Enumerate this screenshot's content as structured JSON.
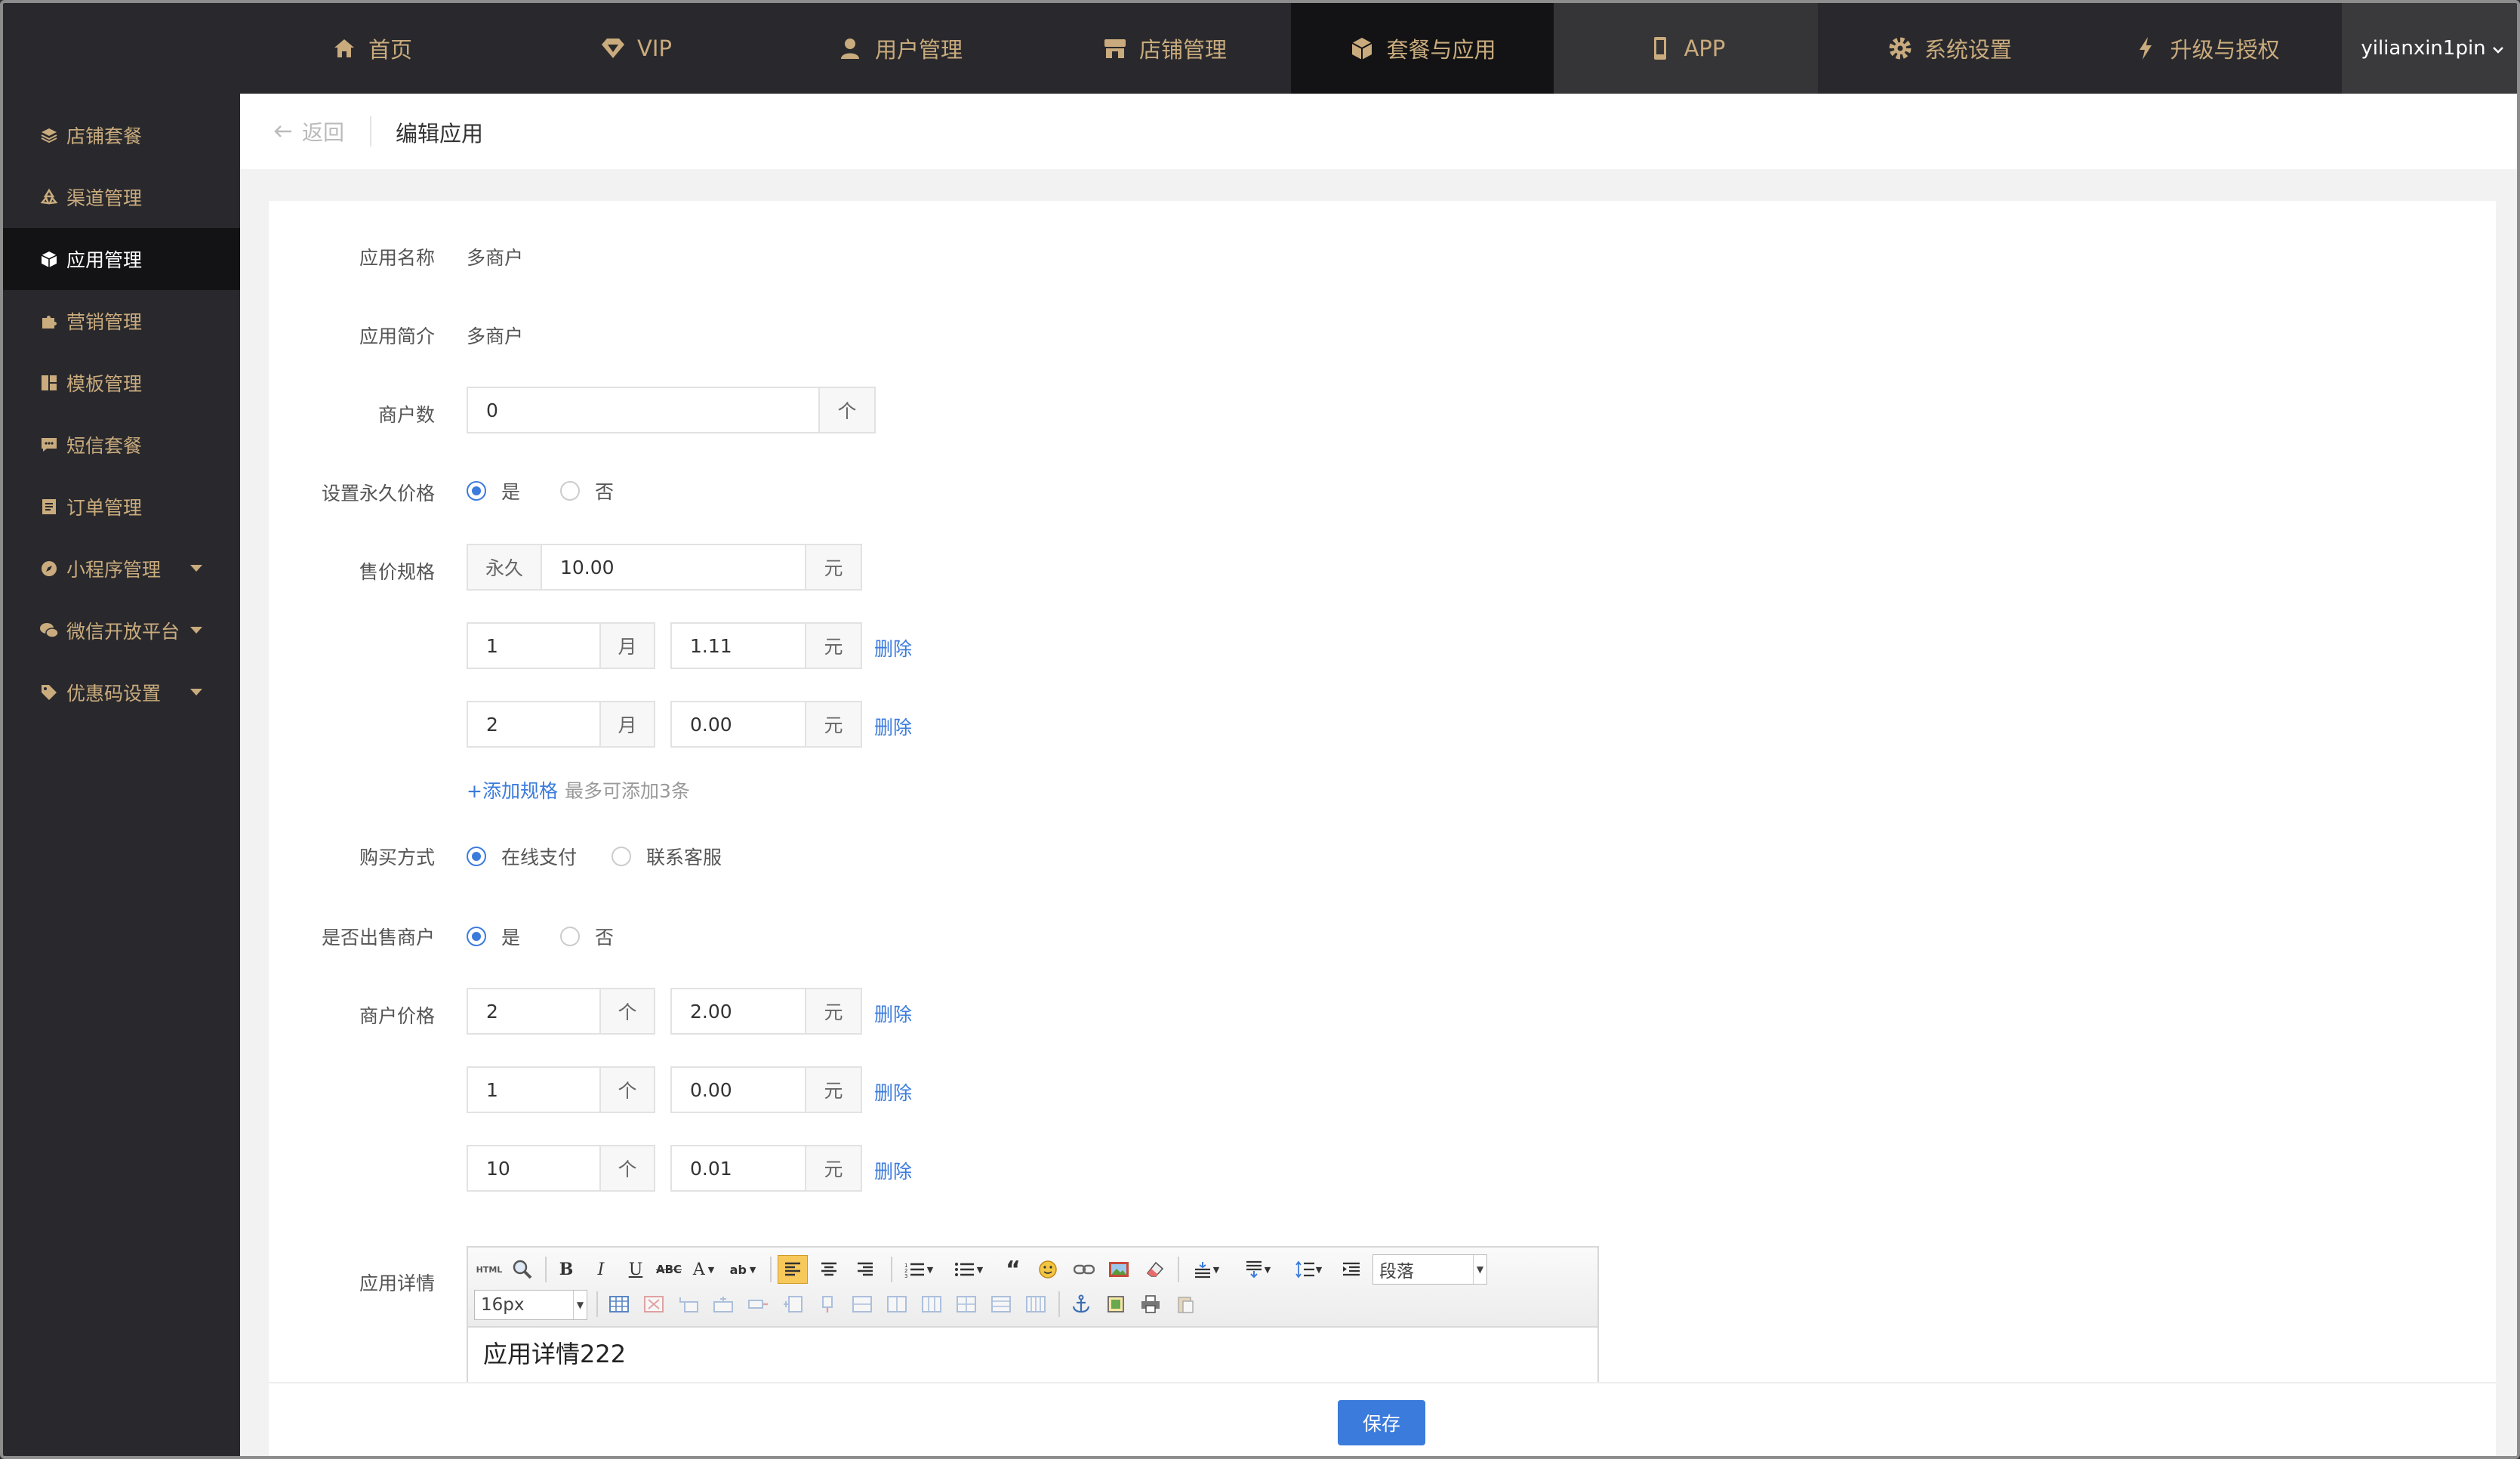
{
  "topnav": {
    "items": [
      {
        "label": "首页",
        "icon": "home-icon"
      },
      {
        "label": "VIP",
        "icon": "diamond-icon"
      },
      {
        "label": "用户管理",
        "icon": "user-icon"
      },
      {
        "label": "店铺管理",
        "icon": "store-icon"
      },
      {
        "label": "套餐与应用",
        "icon": "cube-icon"
      },
      {
        "label": "APP",
        "icon": "phone-icon"
      },
      {
        "label": "系统设置",
        "icon": "gear-icon"
      },
      {
        "label": "升级与授权",
        "icon": "bolt-icon"
      }
    ],
    "active": "套餐与应用",
    "user": "yilianxin1pin"
  },
  "sidebar": {
    "items": [
      {
        "label": "店铺套餐",
        "icon": "layers-icon"
      },
      {
        "label": "渠道管理",
        "icon": "recycle-icon"
      },
      {
        "label": "应用管理",
        "icon": "cube-icon"
      },
      {
        "label": "营销管理",
        "icon": "puzzle-icon"
      },
      {
        "label": "模板管理",
        "icon": "dashboard-icon"
      },
      {
        "label": "短信套餐",
        "icon": "message-icon"
      },
      {
        "label": "订单管理",
        "icon": "document-icon"
      },
      {
        "label": "小程序管理",
        "icon": "compass-icon"
      },
      {
        "label": "微信开放平台",
        "icon": "wechat-icon"
      },
      {
        "label": "优惠码设置",
        "icon": "tag-icon"
      }
    ],
    "active": "应用管理"
  },
  "breadcrumb": {
    "back": "返回",
    "title": "编辑应用"
  },
  "form": {
    "app_name_label": "应用名称",
    "app_name": "多商户",
    "app_intro_label": "应用简介",
    "app_intro": "多商户",
    "merchant_count_label": "商户数",
    "merchant_count": "0",
    "unit_ge": "个",
    "permanent_label": "设置永久价格",
    "yes": "是",
    "no": "否",
    "price_spec_label": "售价规格",
    "permanent_tag": "永久",
    "permanent_price": "10.00",
    "unit_yuan": "元",
    "unit_month": "月",
    "delete": "删除",
    "specs": [
      {
        "months": "1",
        "price": "1.11"
      },
      {
        "months": "2",
        "price": "0.00"
      }
    ],
    "add_spec": "+添加规格",
    "add_spec_hint": "最多可添加3条",
    "purchase_label": "购买方式",
    "purchase_online": "在线支付",
    "purchase_contact": "联系客服",
    "sell_merchant_label": "是否出售商户",
    "merchant_price_label": "商户价格",
    "merchant_prices": [
      {
        "count": "2",
        "price": "2.00"
      },
      {
        "count": "1",
        "price": "0.00"
      },
      {
        "count": "10",
        "price": "0.01"
      }
    ],
    "detail_label": "应用详情",
    "editor_paragraph": "段落",
    "editor_fontsize": "16px",
    "editor_content": "应用详情222"
  },
  "footer": {
    "save": "保存"
  },
  "colors": {
    "accent": "#3b7bdc",
    "nav_text": "#c9ab7d",
    "dark_bg": "#29292d"
  }
}
